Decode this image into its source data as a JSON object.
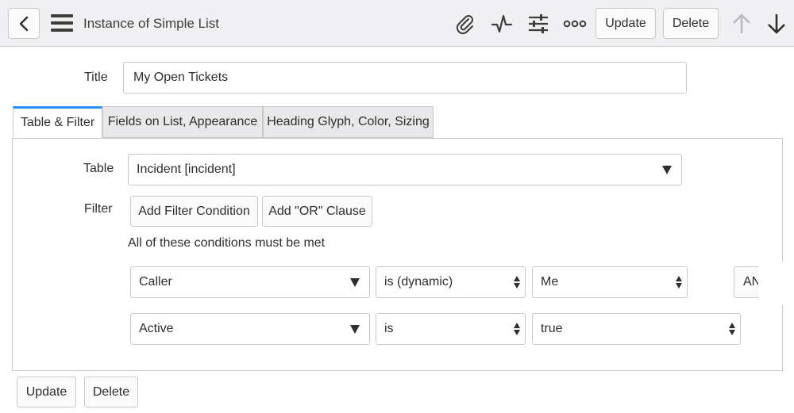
{
  "header": {
    "title": "Instance of Simple List",
    "update_label": "Update",
    "delete_label": "Delete"
  },
  "form": {
    "title_label": "Title",
    "title_value": "My Open Tickets"
  },
  "tabs": [
    {
      "label": "Table & Filter",
      "active": true
    },
    {
      "label": "Fields on List, Appearance",
      "active": false
    },
    {
      "label": "Heading Glyph, Color, Sizing",
      "active": false
    }
  ],
  "panel": {
    "table_label": "Table",
    "table_value": "Incident [incident]",
    "filter_label": "Filter",
    "add_condition_label": "Add Filter Condition",
    "add_or_label": "Add \"OR\" Clause",
    "conditions_text": "All of these conditions must be met",
    "conditions": [
      {
        "field": "Caller",
        "operator": "is (dynamic)",
        "value": "Me",
        "conjunction": "AN"
      },
      {
        "field": "Active",
        "operator": "is",
        "value": "true"
      }
    ]
  },
  "footer": {
    "update_label": "Update",
    "delete_label": "Delete"
  },
  "colors": {
    "header_bg": "#f0f0f2",
    "active_tab_accent": "#278efc",
    "inactive_tab_bg": "#e8e8ea",
    "disabled_arrow": "#b9bcbf"
  },
  "icons": [
    "chevron-left-icon",
    "menu-icon",
    "paperclip-icon",
    "activity-icon",
    "sliders-icon",
    "more-icon",
    "arrow-up-icon",
    "arrow-down-icon"
  ]
}
